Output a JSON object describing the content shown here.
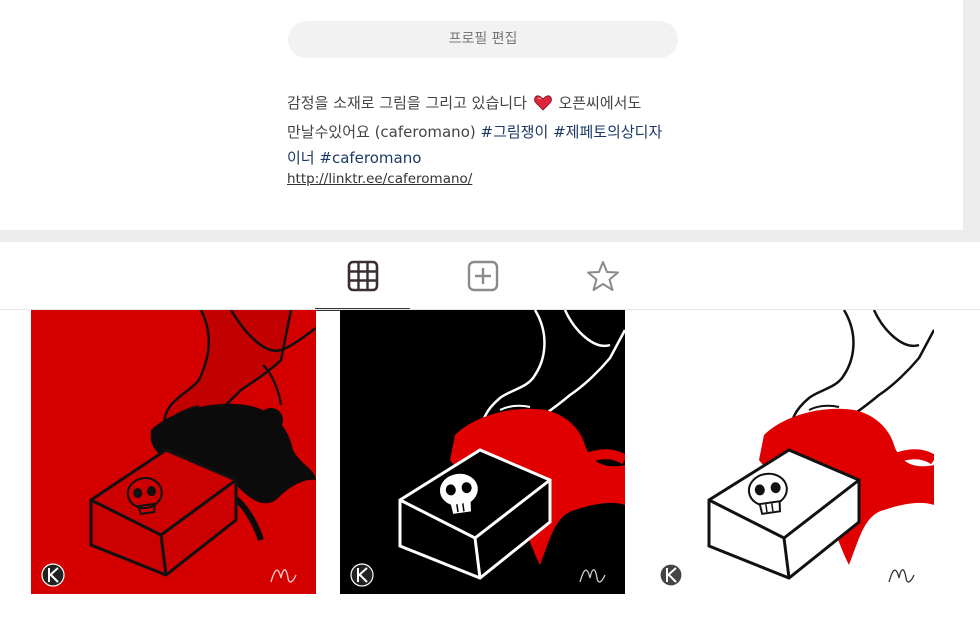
{
  "profile": {
    "edit_button": "프로필 편집",
    "bio_line1_a": "감정을 소재로 그림을 그리고 있습니다",
    "bio_line1_b": "오픈씨에서도",
    "bio_line2_a": "만날수있어요 (caferomano)",
    "bio_tag1": "#그림쟁이",
    "bio_tag2": "#제페토의상디자",
    "bio_tag2_cont": "이너",
    "bio_tag3": "#caferomano",
    "link": "http://linktr.ee/caferomano/"
  },
  "tabs": [
    {
      "name": "grid",
      "icon": "grid-icon",
      "active": true
    },
    {
      "name": "add",
      "icon": "plus-square-icon",
      "active": false
    },
    {
      "name": "favorites",
      "icon": "star-icon",
      "active": false
    }
  ],
  "gallery": [
    {
      "theme": "red",
      "background": "#d40000",
      "stroke": "#111111"
    },
    {
      "theme": "black",
      "background": "#000000",
      "stroke": "#ffffff"
    },
    {
      "theme": "white",
      "background": "#ffffff",
      "stroke": "#111111"
    }
  ],
  "colors": {
    "accent_tag": "#1b3a66",
    "blood_red": "#e00000",
    "page_bg": "#ececec"
  }
}
